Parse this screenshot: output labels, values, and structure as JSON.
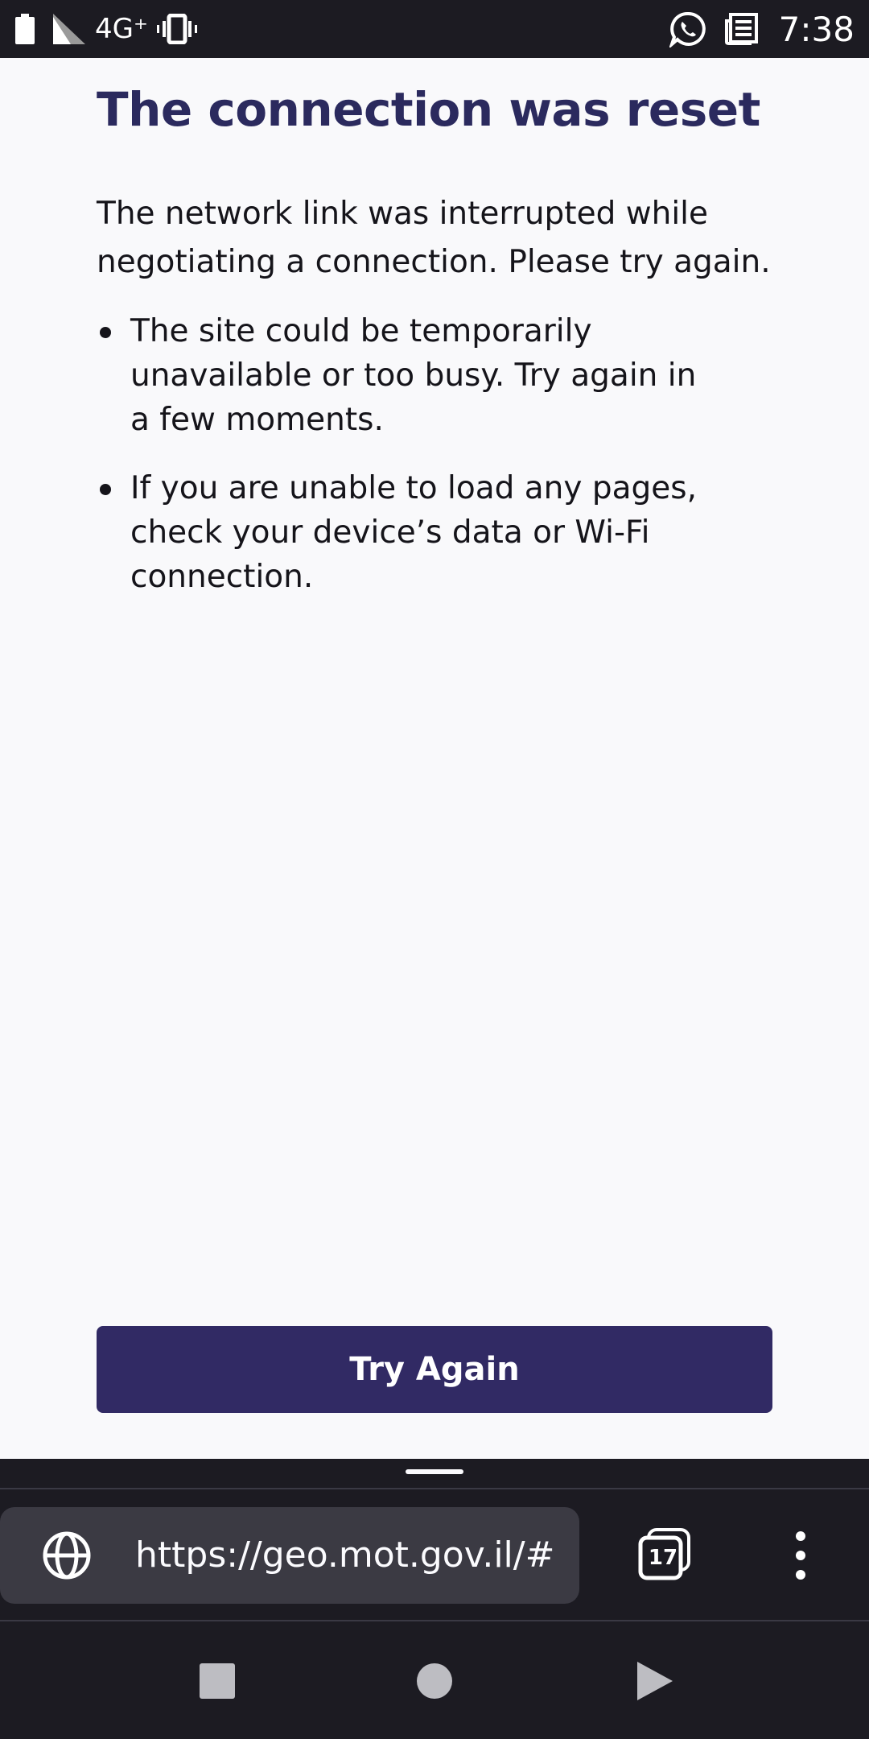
{
  "status_bar": {
    "network": "4G⁺",
    "time": "7:38",
    "icons": [
      "battery-icon",
      "signal-icon",
      "vibrate-icon",
      "whatsapp-icon",
      "news-icon"
    ]
  },
  "error_page": {
    "title": "The connection was reset",
    "description": "The network link was interrupted while negotiating a connection. Please try again.",
    "tips": [
      "The site could be temporarily unavailable or too busy. Try again in a few moments.",
      "If you are unable to load any pages, check your device’s data or Wi-Fi connection."
    ],
    "button_label": "Try Again"
  },
  "toolbar": {
    "url": "https://geo.mot.gov.il/#",
    "tab_count": "17",
    "icons": [
      "globe-icon",
      "tabs-icon",
      "menu-dots-icon"
    ]
  },
  "navigation": {
    "icons": [
      "recents-square-icon",
      "home-circle-icon",
      "back-triangle-icon"
    ]
  },
  "colors": {
    "title": "#2b2a5e",
    "button": "#312a64",
    "page_bg": "#f9f9fb",
    "chrome_bg": "#1c1b22",
    "url_bar_bg": "#3b3a43"
  }
}
